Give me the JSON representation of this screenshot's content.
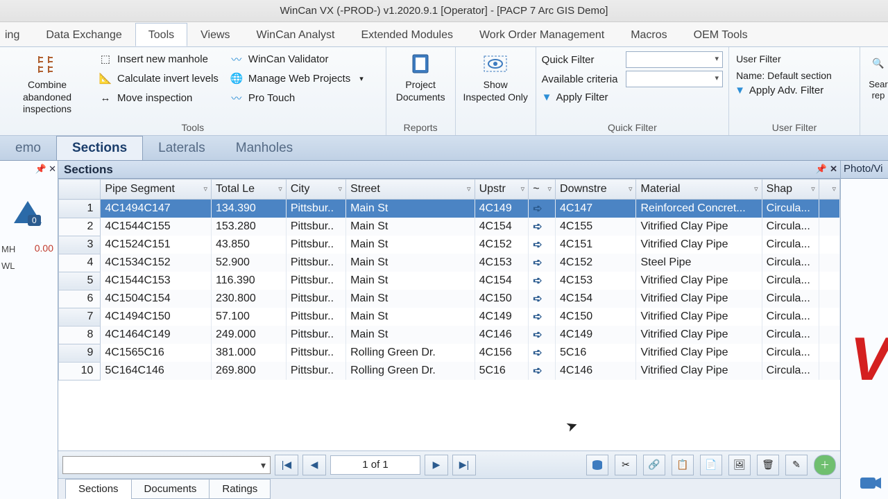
{
  "title": "WinCan VX (-PROD-) v1.2020.9.1 [Operator] - [PACP 7 Arc GIS Demo]",
  "ribbonTabs": [
    "ing",
    "Data Exchange",
    "Tools",
    "Views",
    "WinCan Analyst",
    "Extended Modules",
    "Work Order Management",
    "Macros",
    "OEM Tools"
  ],
  "activeRibbonTab": "Tools",
  "ribbon": {
    "combine": "Combine abandoned inspections",
    "insertMH": "Insert new manhole",
    "calcInvert": "Calculate invert levels",
    "moveInsp": "Move inspection",
    "validator": "WinCan Validator",
    "manageWeb": "Manage Web Projects",
    "proTouch": "Pro Touch",
    "toolsLabel": "Tools",
    "projDocs": "Project Documents",
    "reportsLabel": "Reports",
    "showInsp": "Show Inspected Only",
    "quickFilter": "Quick Filter",
    "availCrit": "Available criteria",
    "applyFilter": "Apply Filter",
    "quickFilterLabel": "Quick Filter",
    "userFilter": "User Filter",
    "nameDefault": "Name: Default section",
    "applyAdv": "Apply Adv. Filter",
    "userFilterLabel": "User Filter",
    "searRep": "Sear\nrep"
  },
  "viewTabs": [
    "emo",
    "Sections",
    "Laterals",
    "Manholes"
  ],
  "activeViewTab": "Sections",
  "leftPanel": {
    "badge": "0",
    "value": "0.00",
    "mh": "MH",
    "wl": "WL"
  },
  "gridTitle": "Sections",
  "columns": [
    "Pipe Segment",
    "Total Le",
    "City",
    "Street",
    "Upstr",
    "~",
    "Downstre",
    "Material",
    "Shap"
  ],
  "rows": [
    {
      "n": 1,
      "seg": "4C1494C147",
      "len": "134.390",
      "city": "Pittsbur..",
      "street": "Main St",
      "up": "4C149",
      "down": "4C147",
      "mat": "Reinforced  Concret...",
      "shape": "Circula..."
    },
    {
      "n": 2,
      "seg": "4C1544C155",
      "len": "153.280",
      "city": "Pittsbur..",
      "street": "Main St",
      "up": "4C154",
      "down": "4C155",
      "mat": "Vitrified Clay Pipe",
      "shape": "Circula..."
    },
    {
      "n": 3,
      "seg": "4C1524C151",
      "len": "43.850",
      "city": "Pittsbur..",
      "street": "Main St",
      "up": "4C152",
      "down": "4C151",
      "mat": "Vitrified Clay Pipe",
      "shape": "Circula..."
    },
    {
      "n": 4,
      "seg": "4C1534C152",
      "len": "52.900",
      "city": "Pittsbur..",
      "street": "Main St",
      "up": "4C153",
      "down": "4C152",
      "mat": "Steel Pipe",
      "shape": "Circula..."
    },
    {
      "n": 5,
      "seg": "4C1544C153",
      "len": "116.390",
      "city": "Pittsbur..",
      "street": "Main St",
      "up": "4C154",
      "down": "4C153",
      "mat": "Vitrified Clay Pipe",
      "shape": "Circula..."
    },
    {
      "n": 6,
      "seg": "4C1504C154",
      "len": "230.800",
      "city": "Pittsbur..",
      "street": "Main St",
      "up": "4C150",
      "down": "4C154",
      "mat": "Vitrified Clay Pipe",
      "shape": "Circula..."
    },
    {
      "n": 7,
      "seg": "4C1494C150",
      "len": "57.100",
      "city": "Pittsbur..",
      "street": "Main St",
      "up": "4C149",
      "down": "4C150",
      "mat": "Vitrified Clay Pipe",
      "shape": "Circula..."
    },
    {
      "n": 8,
      "seg": "4C1464C149",
      "len": "249.000",
      "city": "Pittsbur..",
      "street": "Main St",
      "up": "4C146",
      "down": "4C149",
      "mat": "Vitrified Clay Pipe",
      "shape": "Circula..."
    },
    {
      "n": 9,
      "seg": "4C1565C16",
      "len": "381.000",
      "city": "Pittsbur..",
      "street": "Rolling Green Dr.",
      "up": "4C156",
      "down": "5C16",
      "mat": "Vitrified Clay Pipe",
      "shape": "Circula..."
    },
    {
      "n": 10,
      "seg": "5C164C146",
      "len": "269.800",
      "city": "Pittsbur..",
      "street": "Rolling Green Dr.",
      "up": "5C16",
      "down": "4C146",
      "mat": "Vitrified Clay Pipe",
      "shape": "Circula..."
    }
  ],
  "selectedRow": 1,
  "pager": "1 of 1",
  "bottomTabs": [
    "Sections",
    "Documents",
    "Ratings"
  ],
  "activeBottomTab": "Sections",
  "rightPanel": {
    "header": "Photo/Vi"
  }
}
